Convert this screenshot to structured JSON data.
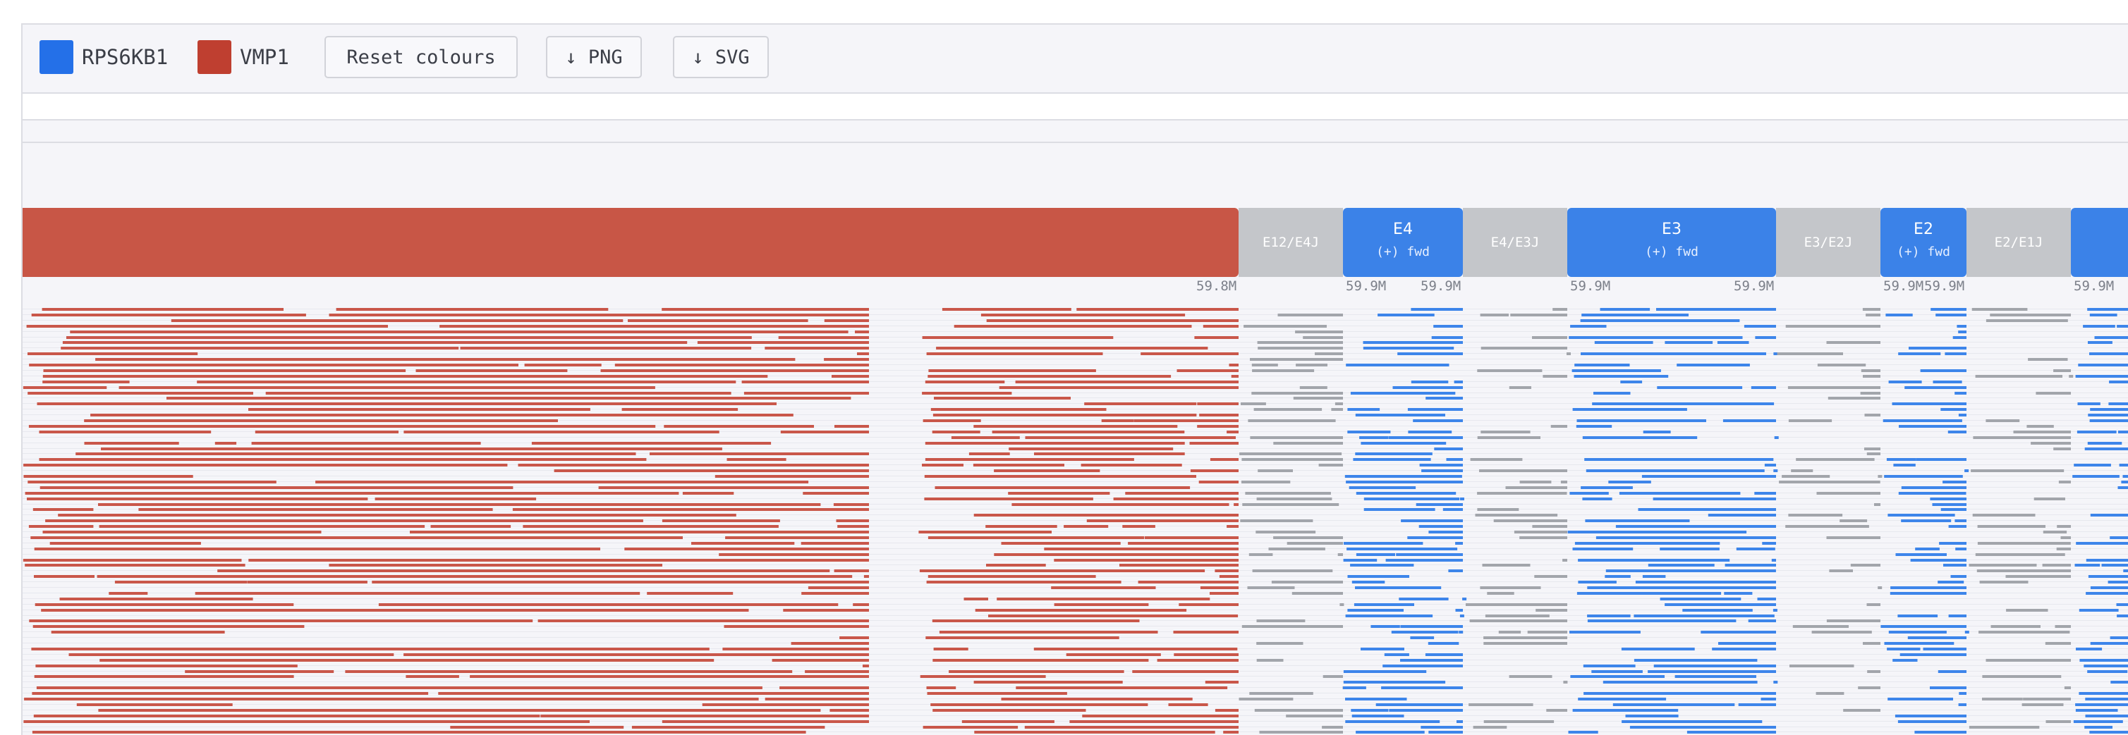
{
  "toolbar": {
    "legend": [
      {
        "label": "RPS6KB1",
        "color": "#2470e8"
      },
      {
        "label": "VMP1",
        "color": "#bf3f30"
      }
    ],
    "reset_label": "Reset colours",
    "png_label": "↓ PNG",
    "svg_label": "↓ SVG"
  },
  "colors": {
    "gene_vmp1": "#c85646",
    "exon_rps6kb1": "#3b82e8",
    "junction": "#c4c6ca",
    "read_vmp1": "#c9574a",
    "read_rps6kb1": "#3d85ea",
    "read_junction": "#a2a5ab"
  },
  "track": {
    "gene_block": {
      "name": "VMP1"
    },
    "segments": [
      {
        "kind": "junction",
        "label": "E12/E4J"
      },
      {
        "kind": "exon",
        "label": "E4",
        "sub": "(+) fwd"
      },
      {
        "kind": "junction",
        "label": "E4/E3J"
      },
      {
        "kind": "exon",
        "label": "E3",
        "sub": "(+) fwd"
      },
      {
        "kind": "junction",
        "label": "E3/E2J"
      },
      {
        "kind": "exon",
        "label": "E2",
        "sub": "(+) fwd"
      },
      {
        "kind": "junction",
        "label": "E2/E1J"
      },
      {
        "kind": "exon",
        "label": "",
        "sub": ""
      }
    ],
    "ticks": [
      "59.8M",
      "59.9M",
      "59.9M",
      "59.9M",
      "59.9M",
      "59.9M",
      "59.9M",
      "59.9M"
    ]
  }
}
